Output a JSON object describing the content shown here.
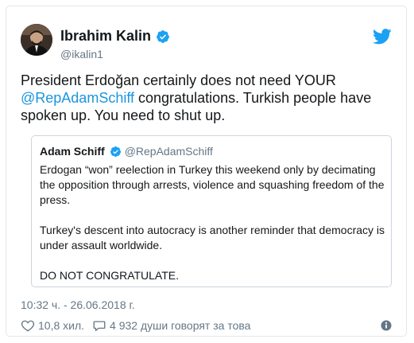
{
  "author": {
    "display_name": "Ibrahim Kalin",
    "handle": "@ikalin1"
  },
  "tweet": {
    "text_before": "President Erdoğan certainly does not need YOUR ",
    "mention": "@RepAdamSchiff",
    "text_after": " congratulations. Turkish people have spoken up. You need to shut up."
  },
  "quoted": {
    "display_name": "Adam Schiff",
    "handle": "@RepAdamSchiff",
    "paragraphs": [
      "Erdogan “won” reelection in Turkey this weekend only by decimating the opposition through arrests, violence and squashing freedom of the press.",
      "Turkey's descent into autocracy is another reminder that democracy is under assault worldwide.",
      "DO NOT CONGRATULATE."
    ]
  },
  "timestamp": "10:32 ч. - 26.06.2018 г.",
  "actions": {
    "likes": "10,8 хил.",
    "replies": "4 932 души говорят за това"
  },
  "colors": {
    "accent": "#1da1f2",
    "mention": "#1b95e0",
    "muted": "#657786"
  },
  "icons": [
    "avatar-photo",
    "verified-badge-icon",
    "twitter-bird-icon",
    "heart-icon",
    "comment-icon",
    "info-icon"
  ]
}
